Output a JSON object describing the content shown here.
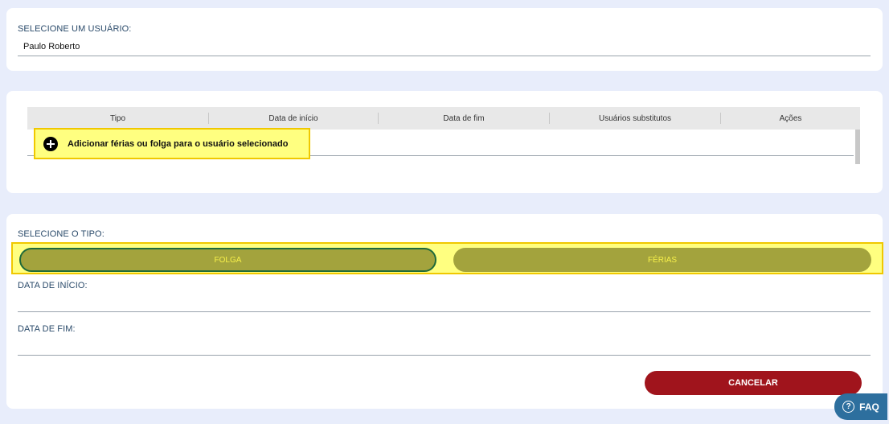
{
  "user_section": {
    "label": "SELECIONE UM USUÁRIO:",
    "value": "Paulo Roberto"
  },
  "table": {
    "columns": [
      "Tipo",
      "Data de início",
      "Data de fim",
      "Usuários substitutos",
      "Ações"
    ],
    "add_button_label": "Adicionar férias ou folga para o usuário selecionado"
  },
  "form": {
    "type_label": "SELECIONE O TIPO:",
    "type_options": [
      "FOLGA",
      "FÉRIAS"
    ],
    "selected_type": "FOLGA",
    "start_date_label": "DATA DE INÍCIO:",
    "end_date_label": "DATA DE FIM:",
    "cancel_label": "CANCELAR"
  },
  "faq": {
    "label": "FAQ",
    "icon_glyph": "?"
  },
  "colors": {
    "background": "#e8edfb",
    "toggle": "#a3a33d",
    "toggle_text": "#f7f04a",
    "highlight": "#ffff80",
    "cancel": "#a0141c",
    "faq": "#2d6f9e"
  }
}
